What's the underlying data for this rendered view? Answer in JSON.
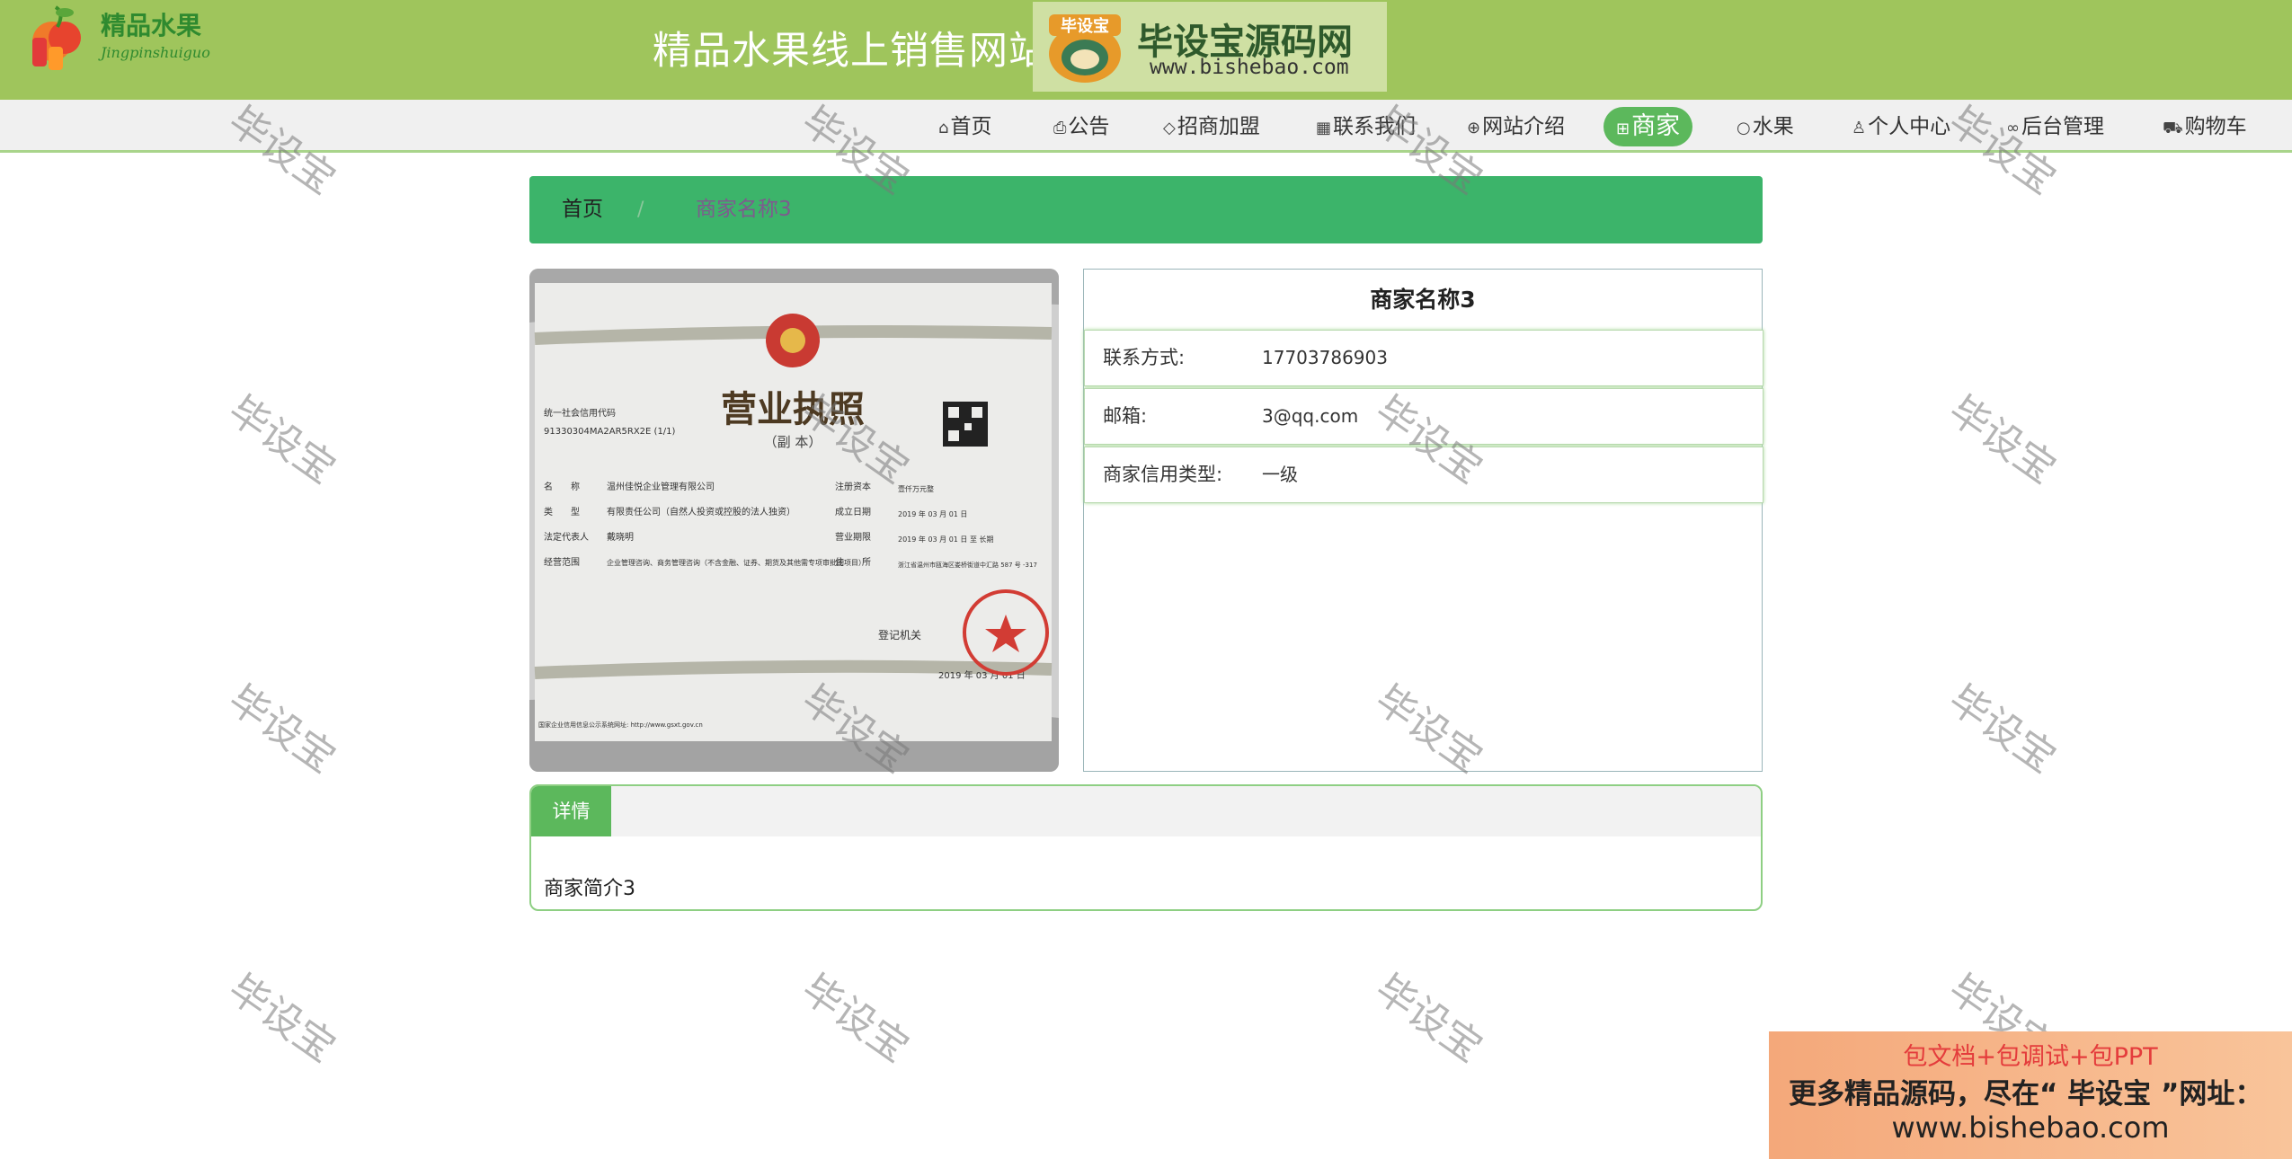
{
  "header": {
    "logo_text": "精品水果",
    "logo_sub": "Jingpinshuiguo",
    "site_title": "精品水果线上销售网站"
  },
  "watermark_logo": {
    "badge": "毕设宝",
    "text": "毕设宝源码网",
    "url": "www.bishebao.com"
  },
  "nav": {
    "items": [
      {
        "label": "首页",
        "icon": "home-icon"
      },
      {
        "label": "公告",
        "icon": "printer-icon"
      },
      {
        "label": "招商加盟",
        "icon": "tag-icon"
      },
      {
        "label": "联系我们",
        "icon": "grid-icon"
      },
      {
        "label": "网站介绍",
        "icon": "globe-icon"
      },
      {
        "label": "商家",
        "icon": "apps-icon",
        "active": true
      },
      {
        "label": "水果",
        "icon": "circle-icon"
      },
      {
        "label": "个人中心",
        "icon": "user-icon"
      },
      {
        "label": "后台管理",
        "icon": "link-icon"
      },
      {
        "label": "购物车",
        "icon": "cart-icon"
      }
    ]
  },
  "breadcrumb": {
    "home": "首页",
    "separator": "/",
    "current": "商家名称3"
  },
  "merchant": {
    "name": "商家名称3",
    "fields": [
      {
        "label": "联系方式:",
        "value": "17703786903"
      },
      {
        "label": "邮箱:",
        "value": "3@qq.com"
      },
      {
        "label": "商家信用类型:",
        "value": "一级"
      }
    ]
  },
  "license_image": {
    "title": "营业执照",
    "subtitle": "（副 本）",
    "credit_code_label": "统一社会信用代码",
    "credit_code": "91330304MA2AR5RX2E (1/1)",
    "rows_left": [
      {
        "k": "名　　称",
        "v": "温州佳悦企业管理有限公司"
      },
      {
        "k": "类　　型",
        "v": "有限责任公司（自然人投资或控股的法人独资）"
      },
      {
        "k": "法定代表人",
        "v": "戴晓明"
      },
      {
        "k": "经营范围",
        "v": "企业管理咨询、商务管理咨询（不含金融、证券、期货及其他需专项审批的项目）"
      }
    ],
    "rows_right": [
      {
        "k": "注册资本",
        "v": "壹仟万元整"
      },
      {
        "k": "成立日期",
        "v": "2019 年 03 月 01 日"
      },
      {
        "k": "营业期限",
        "v": "2019 年 03 月 01 日 至 长期"
      },
      {
        "k": "住　　所",
        "v": "浙江省温州市瓯海区娄桥街道中汇路 587 号 -317"
      }
    ],
    "authority": "登记机关",
    "date": "2019 年 03 月 01 日",
    "footer_url": "国家企业信用信息公示系统网址: http://www.gsxt.gov.cn"
  },
  "detail": {
    "tab": "详情",
    "body": "商家简介3"
  },
  "watermark_text": "毕设宝",
  "ad": {
    "line1": "包文档+包调试+包PPT",
    "line2": "更多精品源码，尽在“ 毕设宝 ”网址：",
    "line3": "www.bishebao.com"
  },
  "colors": {
    "header": "#9fc55c",
    "breadcrumb": "#3cb46a",
    "active_nav": "#5cb85c"
  }
}
